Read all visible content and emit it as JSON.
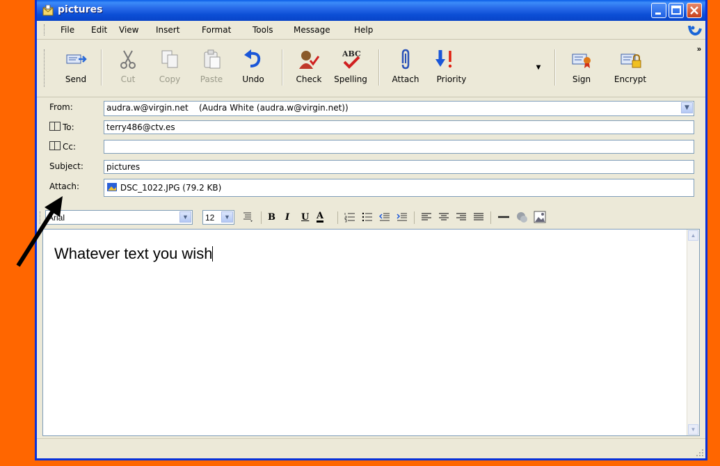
{
  "window": {
    "title": "pictures"
  },
  "menu": {
    "items": [
      "File",
      "Edit",
      "View",
      "Insert",
      "Format",
      "Tools",
      "Message",
      "Help"
    ]
  },
  "toolbar": {
    "buttons": [
      {
        "label": "Send",
        "icon": "send-icon",
        "enabled": true
      },
      {
        "label": "Cut",
        "icon": "scissors-icon",
        "enabled": false
      },
      {
        "label": "Copy",
        "icon": "copy-icon",
        "enabled": false
      },
      {
        "label": "Paste",
        "icon": "clipboard-icon",
        "enabled": false
      },
      {
        "label": "Undo",
        "icon": "undo-icon",
        "enabled": true
      },
      {
        "label": "Check",
        "icon": "check-names-icon",
        "enabled": true
      },
      {
        "label": "Spelling",
        "icon": "spelling-icon",
        "enabled": true
      },
      {
        "label": "Attach",
        "icon": "paperclip-icon",
        "enabled": true
      },
      {
        "label": "Priority",
        "icon": "priority-icon",
        "enabled": true
      },
      {
        "label": "Sign",
        "icon": "sign-icon",
        "enabled": true
      },
      {
        "label": "Encrypt",
        "icon": "encrypt-icon",
        "enabled": true
      }
    ],
    "overflow": "»"
  },
  "fields": {
    "from_label": "From:",
    "from_value": "audra.w@virgin.net    (Audra White (audra.w@virgin.net))",
    "to_label": "To:",
    "to_value": "terry486@ctv.es",
    "cc_label": "Cc:",
    "cc_value": "",
    "subject_label": "Subject:",
    "subject_value": "pictures",
    "attach_label": "Attach:",
    "attach_value": "DSC_1022.JPG (79.2 KB)"
  },
  "format": {
    "font": "Arial",
    "size": "12",
    "bold": "B",
    "italic": "I",
    "underline": "U",
    "color": "A"
  },
  "body": {
    "text": "Whatever text you wish"
  },
  "colors": {
    "background": "#ff6600",
    "window_frame": "#0831d9",
    "window_bg": "#ece9d8"
  }
}
